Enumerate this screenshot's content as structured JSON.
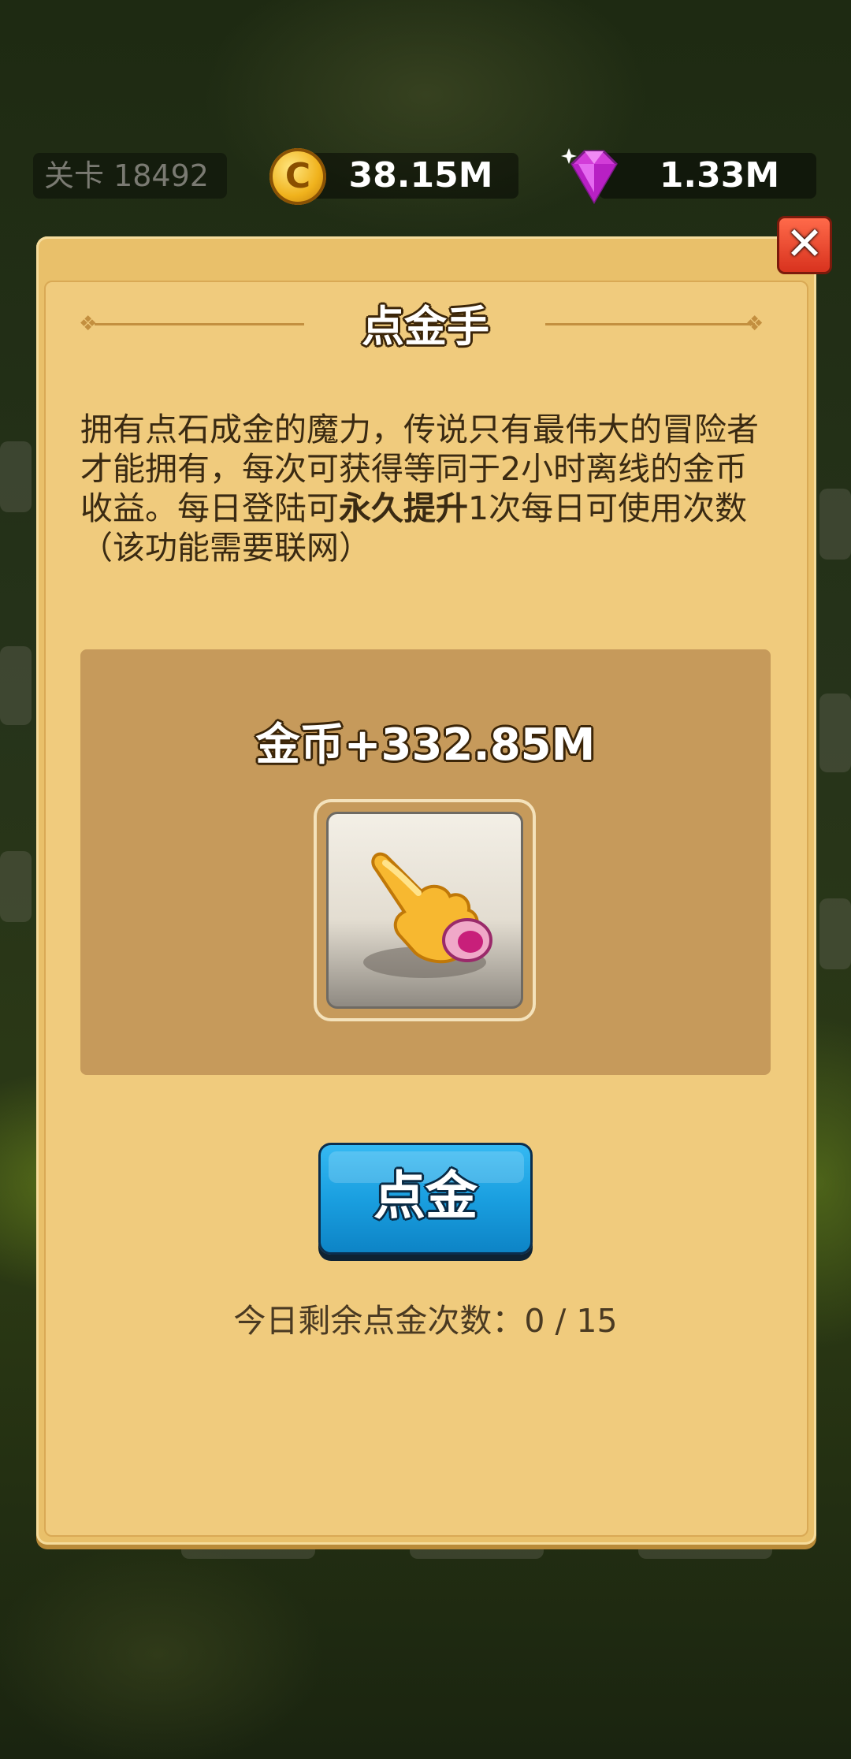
{
  "hud": {
    "level_label": "关卡 18492",
    "coins": "38.15M",
    "gems": "1.33M",
    "coin_icon_glyph": "C"
  },
  "dialog": {
    "title": "点金手",
    "close_glyph": "✕",
    "description_part1": "拥有点石成金的魔力，传说只有最伟大的冒险者才能拥有，每次可获得等同于2小时离线的金币收益。每日登陆可",
    "description_bold": "永久提升",
    "description_part2": "1次每日可使用次数（该功能需要联网）",
    "reward_text": "金币+332.85M",
    "action_button": "点金",
    "remaining_text": "今日剩余点金次数：0 / 15"
  },
  "icons": [
    "coin-icon",
    "gem-icon",
    "close-icon",
    "pointing-hand-icon"
  ],
  "colors": {
    "panel": "#f0cb7d",
    "reward_panel": "#c69a5b",
    "button": "#1a9fe0",
    "close": "#d8321e"
  }
}
